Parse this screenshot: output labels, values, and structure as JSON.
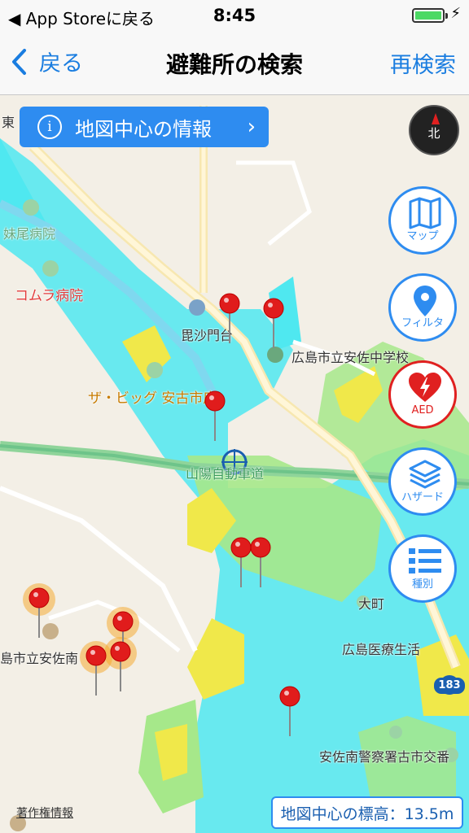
{
  "status_bar": {
    "back_app": "◀ App Storeに戻る",
    "time": "8:45",
    "charging": "⚡"
  },
  "nav": {
    "back_label": "戻る",
    "title": "避難所の検索",
    "research_label": "再検索"
  },
  "map": {
    "info_button_label": "地図中心の情報",
    "compass_label": "北",
    "controls": {
      "map": "マップ",
      "filter": "フィルタ",
      "aed": "AED",
      "hazard": "ハザード",
      "type": "種別"
    },
    "elevation_text": "地図中心の標高：13.5m",
    "copyright": "著作権情報",
    "place_labels": {
      "east_edge": "東",
      "hospital1": "妹尾病院",
      "hospital2": "コムラ病院",
      "bishamon": "毘沙門台",
      "school_jhs": "広島市立安佐中学校",
      "store": "ザ・ビッグ 安古市店",
      "expressway": "山陽自動車道",
      "omachi": "大町",
      "med_college": "広島医療生活",
      "school_south": "島市立安佐南",
      "police": "安佐南警察署古市交番",
      "route": "183"
    },
    "colors": {
      "accent": "#2e8cf0",
      "pin": "#e01c1c",
      "hazard_cyan": "#4fe8f0",
      "hazard_green": "#a6e88a",
      "hazard_yellow": "#f0e84a"
    }
  }
}
